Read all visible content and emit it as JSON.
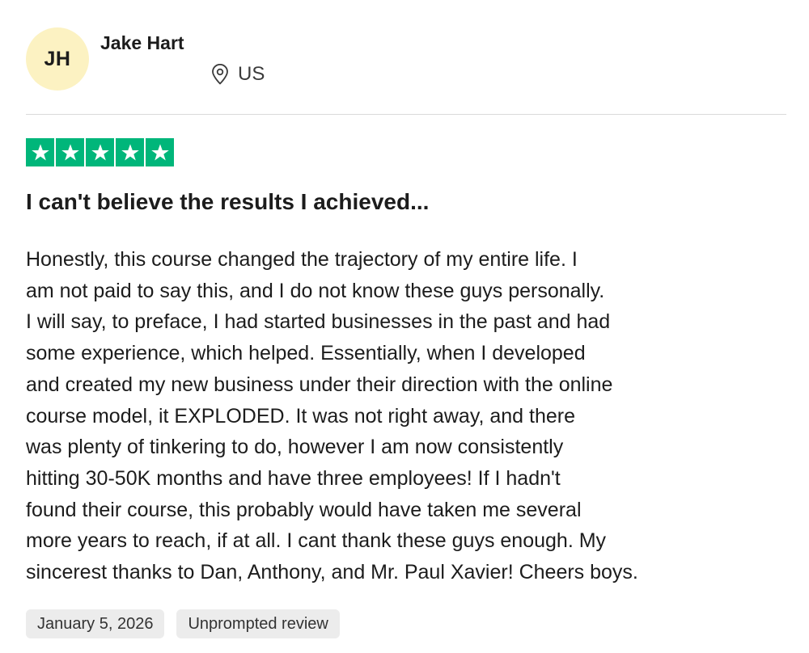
{
  "reviewer": {
    "initials": "JH",
    "name": "Jake Hart",
    "country": "US",
    "avatar_color": "#fcf2c2"
  },
  "rating": {
    "stars": 5,
    "max": 5,
    "color": "#00b67a",
    "icon": "star-icon"
  },
  "review": {
    "title": "I can't believe the results I achieved...",
    "body_lines": [
      "Honestly, this course changed the trajectory of my entire life. I",
      "am not paid to say this, and I do not know these guys personally.",
      "I will say, to preface, I had started businesses in the past and had",
      "some experience, which helped. Essentially, when I developed",
      "and created my new business under their direction with the online",
      "course model, it EXPLODED. It was not right away, and there",
      "was plenty of tinkering to do, however I am now consistently",
      "hitting 30-50K months and have three employees! If I hadn't",
      "found their course, this probably would have taken me several",
      "more years to reach, if at all. I cant thank these guys enough. My",
      "sincerest thanks to Dan, Anthony, and Mr. Paul Xavier! Cheers boys."
    ]
  },
  "tags": {
    "date": "January 5, 2026",
    "review_type": "Unprompted review"
  }
}
